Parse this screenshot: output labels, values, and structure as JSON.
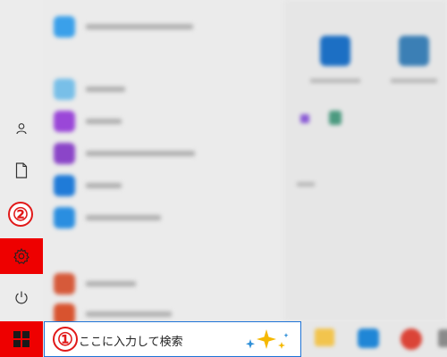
{
  "left_rail": {
    "items": [
      {
        "icon": "user-icon"
      },
      {
        "icon": "document-icon"
      },
      {
        "icon": "pictures-icon"
      },
      {
        "icon": "gear-icon"
      },
      {
        "icon": "power-icon"
      }
    ]
  },
  "annotations": {
    "step1": "①",
    "step2": "②"
  },
  "taskbar": {
    "start_icon": "windows-logo-icon",
    "search": {
      "placeholder": "ここに入力して検索",
      "value": ""
    }
  },
  "colors": {
    "highlight": "#ee0000",
    "search_border": "#1e73d6",
    "badge": "#e11919"
  }
}
